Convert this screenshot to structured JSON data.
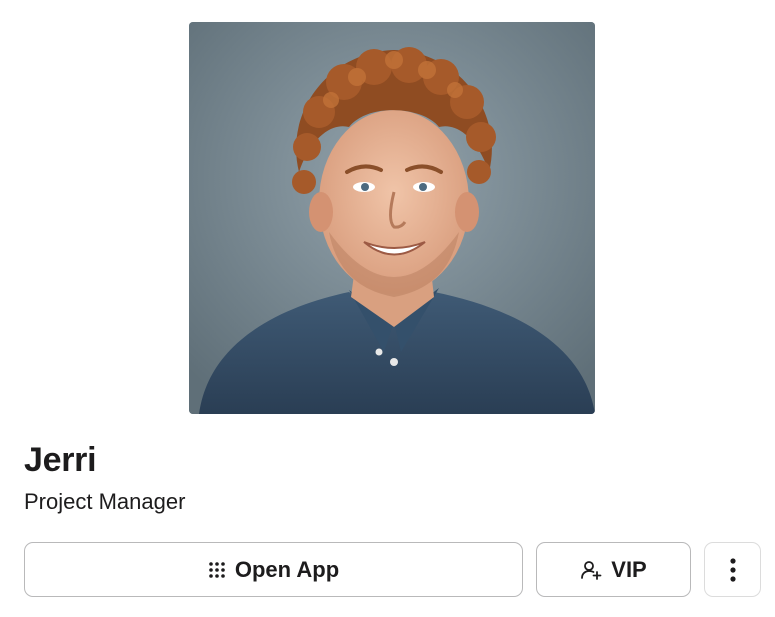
{
  "profile": {
    "name": "Jerri",
    "title": "Project Manager",
    "photo_icon": "profile-photo"
  },
  "actions": {
    "open_app_label": "Open App",
    "open_app_icon": "grid-dots-icon",
    "vip_label": "VIP",
    "vip_icon": "user-plus-icon",
    "more_icon": "vertical-ellipsis-icon"
  }
}
